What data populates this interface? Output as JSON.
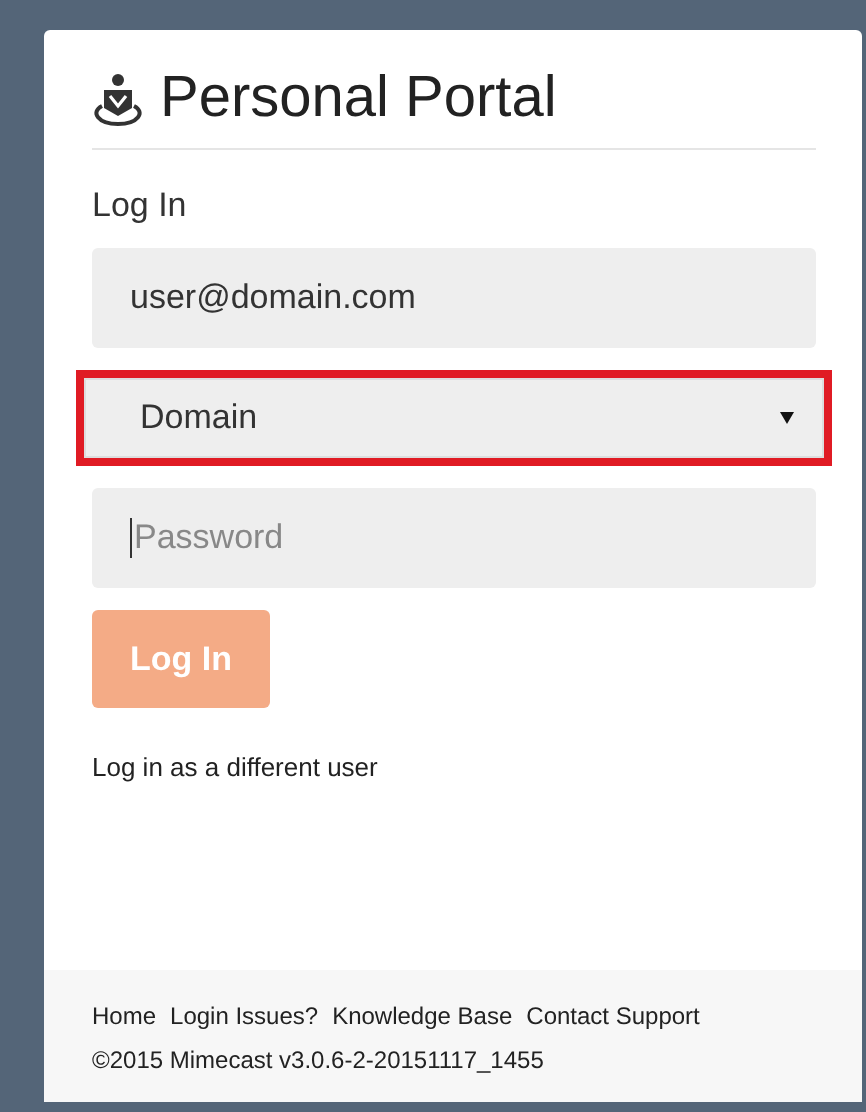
{
  "header": {
    "title": "Personal Portal"
  },
  "form": {
    "heading": "Log In",
    "fields": [
      {
        "kind": "text",
        "value": "user@domain.com",
        "highlighted": false,
        "focused": false
      },
      {
        "kind": "select",
        "value": "Domain",
        "highlighted": true,
        "focused": false
      },
      {
        "kind": "password",
        "placeholder": "Password",
        "highlighted": false,
        "focused": true
      }
    ],
    "submit": {
      "label": "Log In",
      "disabled": true
    },
    "alt_link": "Log in as a different user"
  },
  "footer": {
    "links": [
      "Home",
      "Login Issues?",
      "Knowledge Base",
      "Contact Support"
    ],
    "copyright": "©2015 Mimecast v3.0.6-2-20151117_1455"
  }
}
